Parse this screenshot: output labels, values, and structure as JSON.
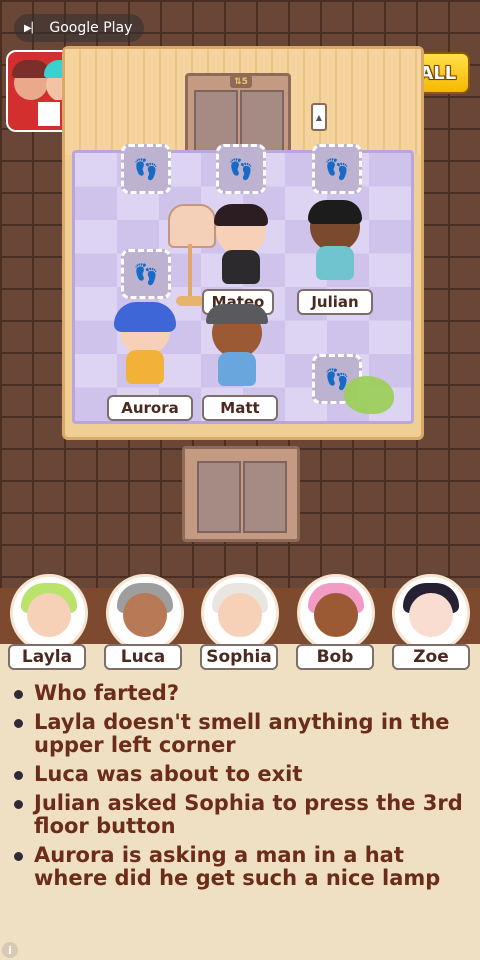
{
  "store_badge": {
    "label": "Google Play",
    "icon": "play-icon"
  },
  "install_button": {
    "label": "INSTALL"
  },
  "elevator": {
    "floor_indicator": "⇅5"
  },
  "characters_in_elevator": [
    {
      "name": "Mateo"
    },
    {
      "name": "Julian"
    },
    {
      "name": "Aurora"
    },
    {
      "name": "Matt"
    }
  ],
  "suspects": [
    {
      "name": "Layla"
    },
    {
      "name": "Luca"
    },
    {
      "name": "Sophia"
    },
    {
      "name": "Bob"
    },
    {
      "name": "Zoe"
    }
  ],
  "clues": [
    "Who farted?",
    "Layla doesn't smell anything in the upper left corner",
    "Luca was about to exit",
    "Julian asked Sophia to press the 3rd floor button",
    "Aurora is asking a man in a hat where did he get such a nice lamp"
  ],
  "info": {
    "icon": "i"
  },
  "colors": {
    "clue_text": "#6b2c1a",
    "install_bg": "#f5b800",
    "fart_cloud": "#9ccf5c"
  }
}
